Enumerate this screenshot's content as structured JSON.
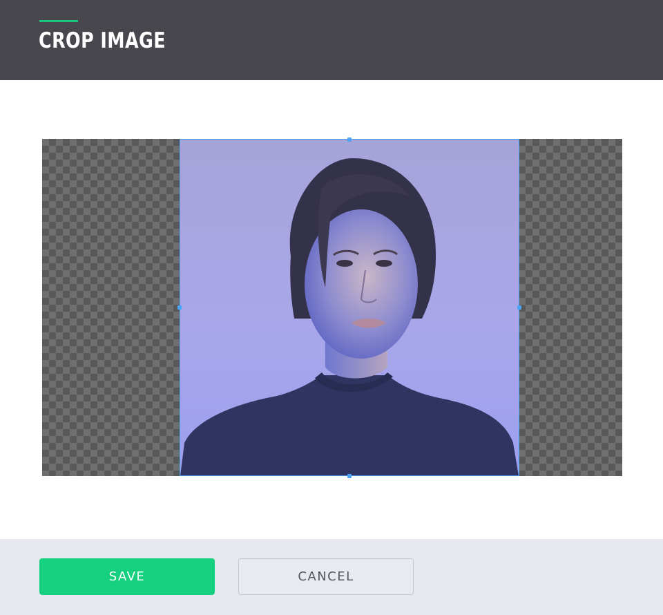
{
  "dialog": {
    "title": "CROP IMAGE"
  },
  "actions": {
    "save_label": "SAVE",
    "cancel_label": "CANCEL"
  },
  "colors": {
    "header_bg": "#48474d",
    "accent": "#19c57a",
    "save_bg": "#14d07f",
    "crop_frame": "#4da3f5",
    "footer_bg": "#e8e9f0"
  },
  "image": {
    "subject": "portrait-photo"
  }
}
